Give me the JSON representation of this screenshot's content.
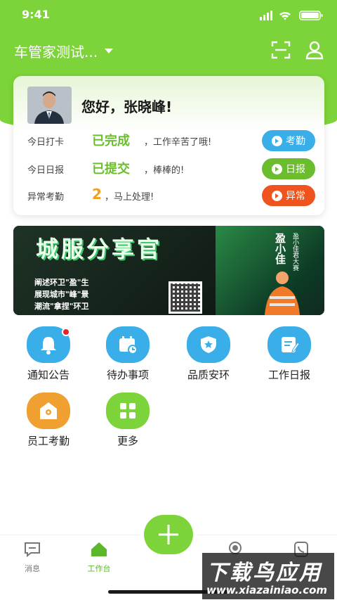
{
  "status_bar": {
    "time": "9:41"
  },
  "header": {
    "company": "车管家测试..."
  },
  "card": {
    "greeting": "您好，张晓峰!",
    "rows": [
      {
        "label": "今日打卡",
        "value": "已完成",
        "note": "，工作辛苦了哦!",
        "button": "考勤",
        "color": "#3aaee8"
      },
      {
        "label": "今日日报",
        "value": "已提交",
        "note": "，棒棒的!",
        "button": "日报",
        "color": "#6cbd2d"
      },
      {
        "label": "异常考勤",
        "value": "2",
        "note": "，马上处理!",
        "button": "异常",
        "color": "#f0541e"
      }
    ]
  },
  "banner": {
    "title": "城服分享官",
    "bullets": [
      "阐述环卫\"盈\"生",
      "展现城市\"峰\"景",
      "潮流\"拿捏\"环卫"
    ],
    "name": "盈小佳",
    "sub": "盈小佳君大赛"
  },
  "grid": [
    {
      "label": "通知公告",
      "color": "#3aaee8",
      "icon": "bell-icon",
      "badge": true
    },
    {
      "label": "待办事项",
      "color": "#3aaee8",
      "icon": "calendar-icon"
    },
    {
      "label": "品质安环",
      "color": "#3aaee8",
      "icon": "shield-star-icon"
    },
    {
      "label": "工作日报",
      "color": "#3aaee8",
      "icon": "report-edit-icon"
    },
    {
      "label": "员工考勤",
      "color": "#f0a030",
      "icon": "location-home-icon"
    },
    {
      "label": "更多",
      "color": "#7dd43a",
      "icon": "grid-apps-icon"
    }
  ],
  "tabbar": {
    "items": [
      {
        "label": "消息",
        "icon": "message-icon"
      },
      {
        "label": "工作台",
        "icon": "workbench-icon",
        "active": true
      }
    ]
  },
  "watermark": {
    "big": "下载鸟应用",
    "small": "www.xiazainiao.com"
  },
  "colors": {
    "brand_green": "#7dd43a",
    "blue": "#3aaee8",
    "orange": "#f0541e"
  }
}
